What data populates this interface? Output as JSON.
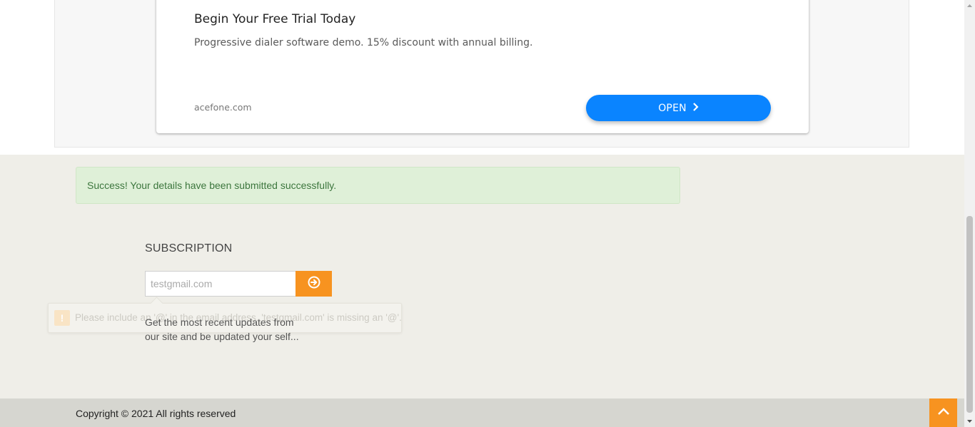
{
  "ad": {
    "headline": "Begin Your Free Trial Today",
    "description": "Progressive dialer software demo. 15% discount with annual billing.",
    "domain": "acefone.com",
    "open_label": "OPEN",
    "button_color": "#0a84ff"
  },
  "alert": {
    "message": "Success! Your details have been submitted successfully.",
    "color": "#dff0d8"
  },
  "subscription": {
    "title": "SUBSCRIPTION",
    "email_value": "testgmail.com",
    "submit_icon": "arrow-circle-right-icon",
    "description": "Get the most recent updates from our site and be updated your self...",
    "accent_color": "#f79320"
  },
  "validation_tooltip": {
    "icon": "warning-icon",
    "message": "Please include an '@' in the email address. 'testgmail.com' is missing an '@'."
  },
  "footer": {
    "copyright": "Copyright © 2021 All rights reserved",
    "back_to_top_icon": "chevron-up-icon"
  }
}
